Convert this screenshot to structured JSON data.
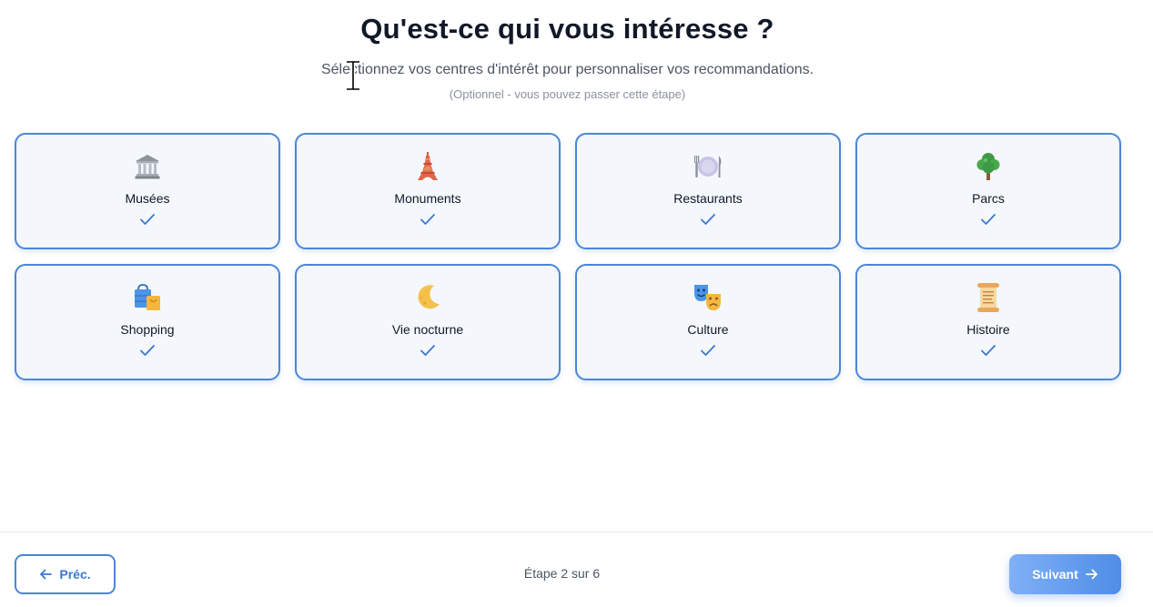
{
  "header": {
    "title": "Qu'est-ce qui vous intéresse ?",
    "subtitle": "Sélectionnez vos centres d'intérêt pour personnaliser vos recommandations.",
    "optional_note": "(Optionnel - vous pouvez passer cette étape)"
  },
  "interests": [
    {
      "label": "Musées",
      "icon": "museum-icon",
      "selected": true
    },
    {
      "label": "Monuments",
      "icon": "eiffel-tower-icon",
      "selected": true
    },
    {
      "label": "Restaurants",
      "icon": "plate-cutlery-icon",
      "selected": true
    },
    {
      "label": "Parcs",
      "icon": "tree-icon",
      "selected": true
    },
    {
      "label": "Shopping",
      "icon": "shopping-bags-icon",
      "selected": true
    },
    {
      "label": "Vie nocturne",
      "icon": "crescent-moon-icon",
      "selected": true
    },
    {
      "label": "Culture",
      "icon": "theater-masks-icon",
      "selected": true
    },
    {
      "label": "Histoire",
      "icon": "scroll-icon",
      "selected": true
    }
  ],
  "footer": {
    "prev_label": "Préc.",
    "step_text": "Étape 2 sur 6",
    "next_label": "Suivant"
  },
  "colors": {
    "accent": "#4a86d8",
    "card_bg": "#f4f7fc",
    "next_gradient_start": "#7fb0f7",
    "next_gradient_end": "#4f8de6"
  }
}
